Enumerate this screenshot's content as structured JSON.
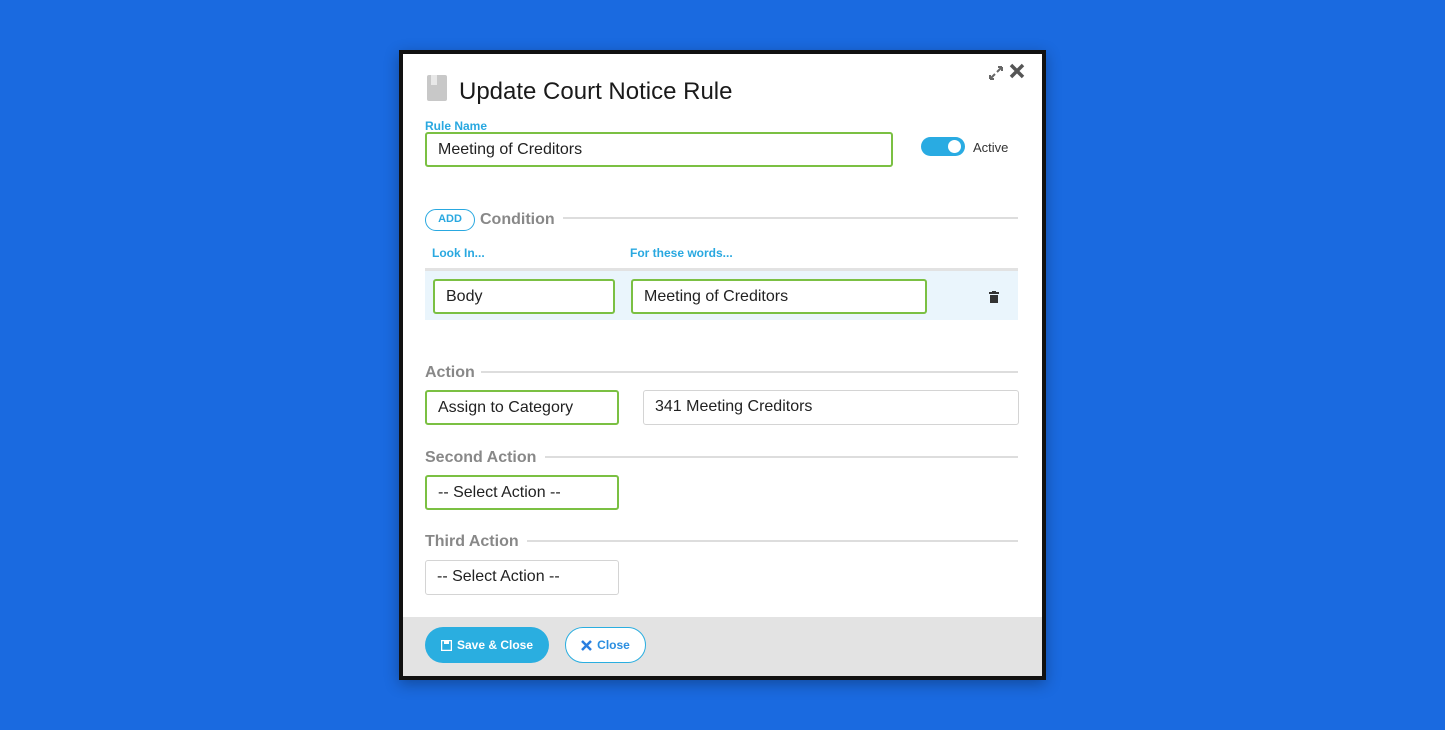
{
  "dialog": {
    "title": "Update Court Notice Rule",
    "title_icon": "book-icon"
  },
  "rule_name": {
    "label": "Rule Name",
    "value": "Meeting of Creditors"
  },
  "active": {
    "label": "Active",
    "on": true,
    "color": "#29abe2"
  },
  "condition": {
    "add_label": "ADD",
    "title": "Condition",
    "col_look_in": "Look In...",
    "col_words": "For these words...",
    "rows": [
      {
        "look_in": "Body",
        "words": "Meeting of Creditors"
      }
    ]
  },
  "action": {
    "title": "Action",
    "type": "Assign to Category",
    "value": "341 Meeting Creditors"
  },
  "second_action": {
    "title": "Second Action",
    "value": "-- Select Action --"
  },
  "third_action": {
    "title": "Third Action",
    "value": "-- Select Action --"
  },
  "footer": {
    "save_label": "Save & Close",
    "close_label": "Close"
  },
  "colors": {
    "accent": "#29abe2",
    "valid_border": "#7bc043",
    "background": "#1a6ae0"
  }
}
